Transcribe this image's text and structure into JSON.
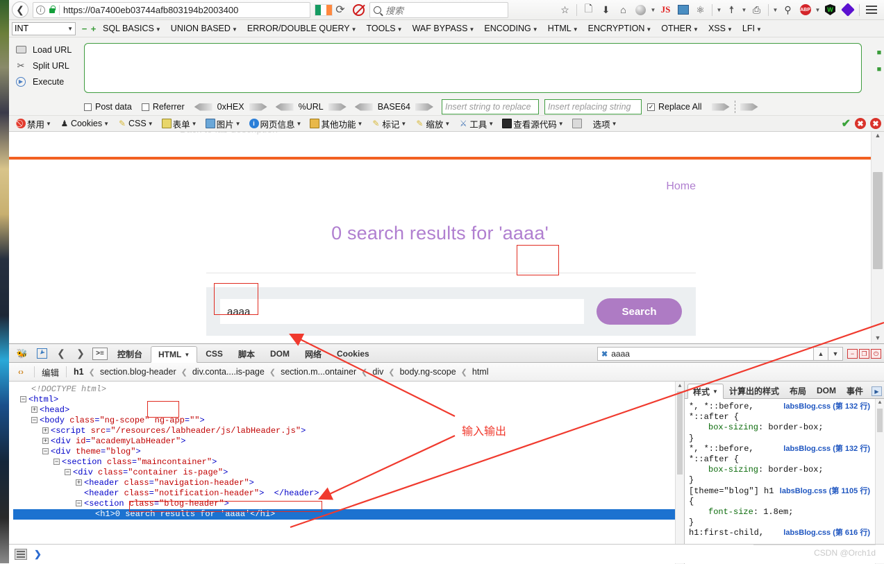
{
  "browser": {
    "url": "https://0a7400eb03744afb803194b2003400",
    "back_icon": "back-arrow-icon",
    "info_icon": "info-icon",
    "lock_icon": "lock-icon",
    "reload_icon": "reload-icon",
    "flag_icon": "ireland-flag-icon",
    "noscript_icon": "noscript-icon",
    "search_placeholder": "搜索",
    "toolbar_icons": [
      {
        "name": "bookmark-star-icon",
        "glyph": "☆"
      },
      {
        "name": "reading-list-icon",
        "glyph": "☰"
      },
      {
        "name": "downloads-icon",
        "glyph": "⬇"
      },
      {
        "name": "home-icon",
        "glyph": "⌂"
      },
      {
        "name": "ghostery-icon",
        "glyph": "●"
      },
      {
        "name": "javascript-toggle-icon",
        "glyph": "JS"
      },
      {
        "name": "proxy-switch-icon",
        "glyph": "❐"
      },
      {
        "name": "palette-icon",
        "glyph": "◔"
      },
      {
        "name": "tamper-data-icon",
        "glyph": "⛃"
      },
      {
        "name": "user-agent-icon",
        "glyph": "⎕"
      },
      {
        "name": "zoom-icon",
        "glyph": "⚲"
      },
      {
        "name": "adblock-plus-icon",
        "glyph": "ABP"
      },
      {
        "name": "wappalyzer-icon",
        "glyph": "W"
      },
      {
        "name": "hackbar-icon",
        "glyph": "◆"
      },
      {
        "name": "menu-hamburger-icon",
        "glyph": "☰"
      }
    ]
  },
  "hackbar": {
    "type_select": "INT",
    "minus_label": "−",
    "plus_label": "+",
    "menus": [
      "SQL BASICS",
      "UNION BASED",
      "ERROR/DOUBLE QUERY",
      "TOOLS",
      "WAF BYPASS",
      "ENCODING",
      "HTML",
      "ENCRYPTION",
      "OTHER",
      "XSS",
      "LFI"
    ],
    "actions": [
      {
        "label": "Load URL",
        "icon": "load-url-icon"
      },
      {
        "label": "Split URL",
        "icon": "split-url-icon"
      },
      {
        "label": "Execute",
        "icon": "execute-icon"
      }
    ],
    "url_textarea_value": "",
    "options": [
      {
        "label": "Post data",
        "type": "checkbox",
        "checked": false
      },
      {
        "label": "Referrer",
        "type": "checkbox",
        "checked": false
      }
    ],
    "encoders": [
      "0xHEX",
      "%URL",
      "BASE64"
    ],
    "replace_from_placeholder": "Insert string to replace",
    "replace_to_placeholder": "Insert replacing string",
    "replace_all_label": "Replace All",
    "replace_all_checked": true
  },
  "webdev_toolbar": {
    "items": [
      {
        "label": "禁用",
        "icon": "disable-icon"
      },
      {
        "label": "Cookies",
        "icon": "cookies-icon"
      },
      {
        "label": "CSS",
        "icon": "css-icon"
      },
      {
        "label": "表单",
        "icon": "forms-icon"
      },
      {
        "label": "图片",
        "icon": "images-icon"
      },
      {
        "label": "网页信息",
        "icon": "page-info-icon"
      },
      {
        "label": "其他功能",
        "icon": "misc-icon"
      },
      {
        "label": "标记",
        "icon": "outline-icon"
      },
      {
        "label": "缩放",
        "icon": "resize-icon"
      },
      {
        "label": "工具",
        "icon": "tools-icon"
      },
      {
        "label": "查看源代码",
        "icon": "view-source-icon"
      },
      {
        "label": "选项",
        "icon": "options-icon"
      }
    ],
    "right_icons": [
      {
        "name": "validate-ok-icon",
        "glyph": "✔"
      },
      {
        "name": "error-icon-1",
        "glyph": "✖"
      },
      {
        "name": "error-icon-2",
        "glyph": "✖"
      }
    ]
  },
  "page": {
    "back_to_lab": "Back to lab description »",
    "home_link": "Home",
    "heading": "0 search results for 'aaaa'",
    "search_value": "aaaa",
    "search_button": "Search",
    "accent_orange": "#f26122",
    "accent_purple": "#b07fd0",
    "button_purple": "#ae7bc4"
  },
  "devtools": {
    "tabs": [
      "控制台",
      "HTML",
      "CSS",
      "脚本",
      "DOM",
      "网络",
      "Cookies"
    ],
    "active_tab": "HTML",
    "search_value": "aaaa",
    "window_buttons": [
      {
        "name": "minimize-button",
        "glyph": "−"
      },
      {
        "name": "detach-button",
        "glyph": "❐"
      },
      {
        "name": "close-button",
        "glyph": "⏻"
      }
    ],
    "edit_label": "编辑",
    "breadcrumbs": [
      "h1",
      "section.blog-header",
      "div.conta....is-page",
      "section.m...ontainer",
      "div",
      "body.ng-scope",
      "html"
    ],
    "html_lines": [
      {
        "indent": 1,
        "type": "doctype",
        "text": "<!DOCTYPE html>"
      },
      {
        "indent": 0,
        "toggle": "minus",
        "text": "<html>"
      },
      {
        "indent": 1,
        "toggle": "plus",
        "text": "<head>"
      },
      {
        "indent": 1,
        "toggle": "minus",
        "tag": "body",
        "attrs": [
          [
            "class",
            "ng-scope"
          ],
          [
            "ng-app",
            ""
          ]
        ]
      },
      {
        "indent": 2,
        "toggle": "plus",
        "tag": "script",
        "attrs": [
          [
            "src",
            "/resources/labheader/js/labHeader.js"
          ]
        ]
      },
      {
        "indent": 2,
        "toggle": "plus",
        "tag": "div",
        "attrs": [
          [
            "id",
            "academyLabHeader"
          ]
        ]
      },
      {
        "indent": 2,
        "toggle": "minus",
        "tag": "div",
        "attrs": [
          [
            "theme",
            "blog"
          ]
        ]
      },
      {
        "indent": 3,
        "toggle": "minus",
        "tag": "section",
        "attrs": [
          [
            "class",
            "maincontainer"
          ]
        ]
      },
      {
        "indent": 4,
        "toggle": "minus",
        "tag": "div",
        "attrs": [
          [
            "class",
            "container is-page"
          ]
        ]
      },
      {
        "indent": 5,
        "toggle": "plus",
        "tag": "header",
        "attrs": [
          [
            "class",
            "navigation-header"
          ]
        ]
      },
      {
        "indent": 5,
        "toggle": "none",
        "tag": "header",
        "attrs": [
          [
            "class",
            "notification-header"
          ]
        ],
        "close": "</header>"
      },
      {
        "indent": 5,
        "toggle": "minus",
        "tag": "section",
        "attrs": [
          [
            "class",
            "blog-header"
          ]
        ]
      },
      {
        "indent": 6,
        "toggle": "none",
        "selected": true,
        "text": "<h1>0 search results for 'aaaa'</h1>"
      }
    ],
    "side_tabs": [
      "样式",
      "计算出的样式",
      "布局",
      "DOM",
      "事件"
    ],
    "side_active_tab": "样式",
    "css_rules": [
      {
        "selector_lines": [
          "*, *::before,",
          "*::after {"
        ],
        "source": "labsBlog.css (第 132 行)",
        "declarations": [
          {
            "prop": "box-sizing",
            "value": "border-box;"
          }
        ],
        "close": "}"
      },
      {
        "selector_lines": [
          "*, *::before,",
          "*::after {"
        ],
        "source": "labsBlog.css (第 132 行)",
        "declarations": [
          {
            "prop": "box-sizing",
            "value": "border-box;"
          }
        ],
        "close": "}"
      },
      {
        "selector_lines": [
          "[theme=\"blog\"] h1",
          "{"
        ],
        "source": "labsBlog.css (第 1105 行)",
        "declarations": [
          {
            "prop": "font-size",
            "value": "1.8em;"
          }
        ],
        "close": "}"
      },
      {
        "selector_lines": [
          "h1:first-child,"
        ],
        "source": "labsBlog.css (第 616 行)",
        "declarations": [],
        "close": ""
      }
    ]
  },
  "annotations": {
    "label": "输入输出",
    "color": "#f03a2e"
  },
  "watermark": "CSDN @Orch1d"
}
